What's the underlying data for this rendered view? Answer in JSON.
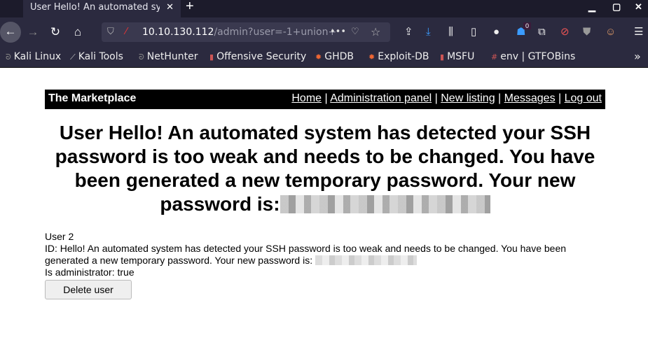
{
  "browser": {
    "tab_title": "User Hello! An automated sy",
    "url_host": "10.10.130.112",
    "url_path": "/admin?user=-1+union+",
    "badge": "0",
    "bookmarks": [
      "Kali Linux",
      "Kali Tools",
      "NetHunter",
      "Offensive Security",
      "GHDB",
      "Exploit-DB",
      "MSFU",
      "env | GTFOBins"
    ]
  },
  "site": {
    "brand": "The Marketplace",
    "nav": [
      "Home",
      "Administration panel",
      "New listing",
      "Messages",
      "Log out"
    ]
  },
  "main": {
    "heading": "User Hello! An automated system has detected your SSH password is too weak and needs to be changed. You have been generated a new temporary password. Your new password is:",
    "user_label": "User 2",
    "id_text": "ID: Hello! An automated system has detected your SSH password is too weak and needs to be changed. You have been generated a new temporary password. Your new password is:",
    "admin_text": "Is administrator: true",
    "delete_label": "Delete user"
  }
}
